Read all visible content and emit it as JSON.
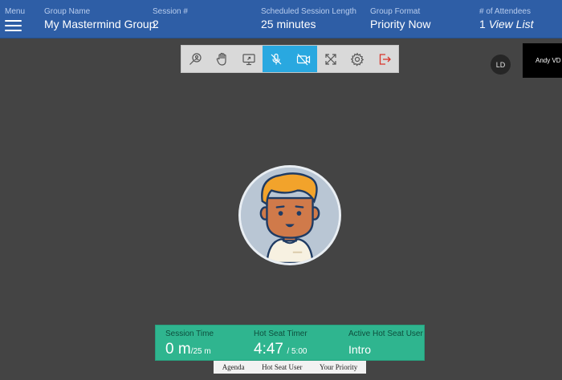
{
  "header": {
    "menu_label": "Menu",
    "group_name_label": "Group Name",
    "group_name": "My Mastermind Group.",
    "session_label": "Session #",
    "session_value": "2",
    "length_label": "Scheduled Session Length",
    "length_value": "25 minutes",
    "format_label": "Group Format",
    "format_value": "Priority Now",
    "attendees_label": "# of Attendees",
    "attendees_count": "1",
    "attendees_link": "View List"
  },
  "toolbar": {
    "buttons": [
      {
        "icon": "search-users-icon",
        "active": false
      },
      {
        "icon": "raise-hand-icon",
        "active": false
      },
      {
        "icon": "screen-share-icon",
        "active": false
      },
      {
        "icon": "mic-off-icon",
        "active": true
      },
      {
        "icon": "camera-off-icon",
        "active": true
      },
      {
        "icon": "fullscreen-icon",
        "active": false
      },
      {
        "icon": "gear-icon",
        "active": false
      },
      {
        "icon": "exit-icon",
        "active": false
      }
    ]
  },
  "participants": {
    "self_initials": "LD",
    "remote_name": "Andy VD ("
  },
  "session": {
    "time_label": "Session Time",
    "time_value": "0 m",
    "time_total": "/25 m",
    "hot_seat_timer_label": "Hot Seat Timer",
    "hot_seat_timer_value": "4:47",
    "hot_seat_timer_total": "/ 5:00",
    "active_user_label": "Active Hot Seat User",
    "active_user_value": "Intro"
  },
  "tabs": [
    "Agenda",
    "Hot Seat User",
    "Your Priority"
  ],
  "colors": {
    "header_bg": "#2e5ea6",
    "stage_bg": "#444444",
    "toolbar_active": "#29a8e0",
    "panel_green": "#2fb58f",
    "exit_red": "#d9342b"
  }
}
